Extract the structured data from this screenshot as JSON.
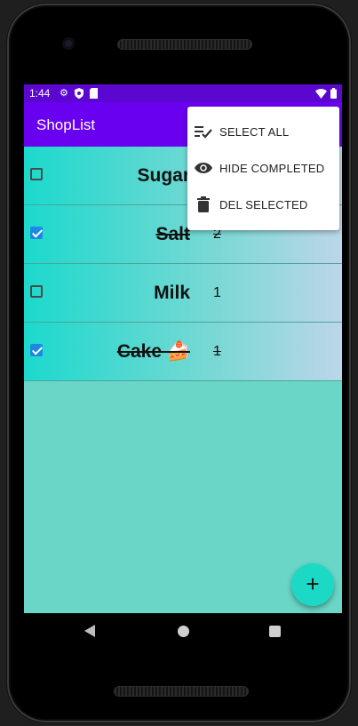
{
  "status": {
    "time": "1:44",
    "icons": [
      "gear-icon",
      "shield-icon",
      "sd-card-icon"
    ],
    "right_icons": [
      "wifi-icon",
      "battery-icon"
    ]
  },
  "app": {
    "title": "ShopList"
  },
  "items": [
    {
      "name": "Sugar",
      "qty": "",
      "checked": false
    },
    {
      "name": "Salt",
      "qty": "2",
      "checked": true
    },
    {
      "name": "Milk",
      "qty": "1",
      "checked": false
    },
    {
      "name": "Cake 🍰",
      "qty": "1",
      "checked": true
    }
  ],
  "menu": [
    {
      "label": "SELECT ALL",
      "icon": "checklist-icon"
    },
    {
      "label": "HIDE COMPLETED",
      "icon": "eye-icon"
    },
    {
      "label": "DEL SELECTED",
      "icon": "trash-icon"
    }
  ],
  "fab": {
    "label": "+"
  },
  "colors": {
    "status_bar": "#5b07d0",
    "app_bar": "#6a00f0",
    "accent": "#1cd9c6",
    "checkbox": "#1e88e5",
    "background": "#69d6c7"
  }
}
